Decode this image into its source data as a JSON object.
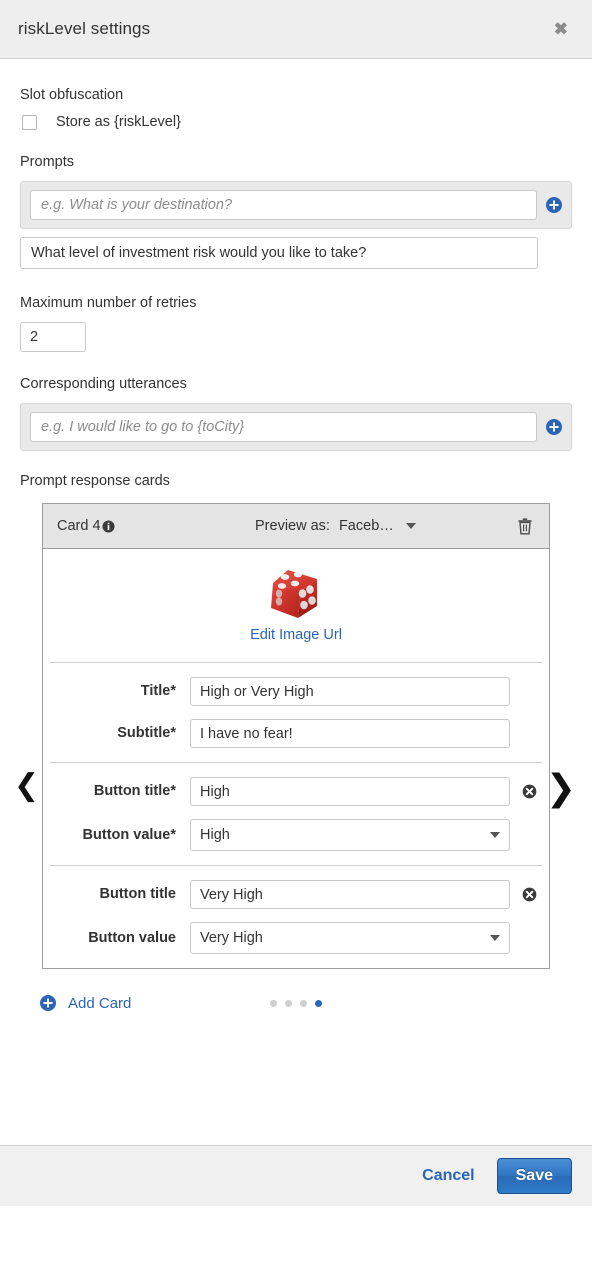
{
  "dialog": {
    "title": "riskLevel settings",
    "close_label": "✖"
  },
  "slot_obfuscation": {
    "section_label": "Slot obfuscation",
    "checkbox_label": "Store as {riskLevel}",
    "checked": false
  },
  "prompts": {
    "section_label": "Prompts",
    "new_prompt_placeholder": "e.g. What is your destination?",
    "new_prompt_value": "",
    "existing": [
      "What level of investment risk would you like to take?"
    ]
  },
  "retries": {
    "label": "Maximum number of retries",
    "value": "2"
  },
  "utterances": {
    "section_label": "Corresponding utterances",
    "placeholder": "e.g. I would like to go to {toCity}",
    "value": ""
  },
  "response_cards": {
    "section_label": "Prompt response cards",
    "card": {
      "title": "Card 4",
      "preview_label": "Preview as:",
      "preview_value": "Faceb…",
      "image_link_label": "Edit Image Url",
      "fields": [
        {
          "label": "Title*",
          "value": "High or Very High"
        },
        {
          "label": "Subtitle*",
          "value": "I have no fear!"
        }
      ],
      "buttons": [
        {
          "title_label": "Button title*",
          "title_value": "High",
          "value_label": "Button value*",
          "value_value": "High"
        },
        {
          "title_label": "Button title",
          "title_value": "Very High",
          "value_label": "Button value",
          "value_value": "Very High"
        }
      ]
    },
    "add_card_label": "Add Card",
    "pagination": {
      "count": 4,
      "active_index": 3
    }
  },
  "footer": {
    "cancel_label": "Cancel",
    "save_label": "Save"
  },
  "colors": {
    "accent_blue": "#2b65b7",
    "header_bg": "#eeeeee",
    "card_header_bg": "#e4e4e4"
  }
}
